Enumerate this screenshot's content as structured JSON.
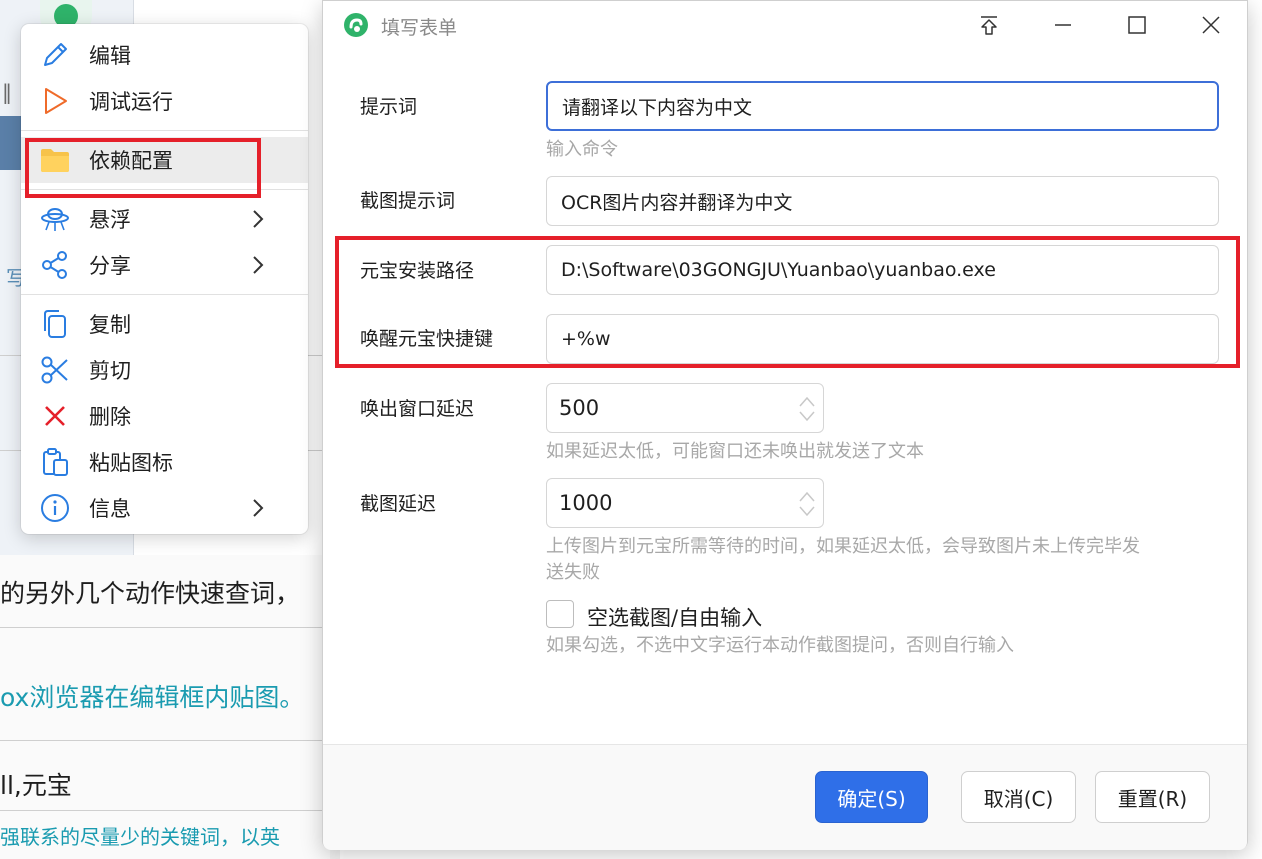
{
  "background": {
    "line1": "的另外几个动作快速查词，",
    "line2": "ox浏览器在编辑框内贴图。",
    "line3": "ll,元宝",
    "line4": "强联系的尽量少的关键词，以英"
  },
  "context_menu": {
    "items": [
      {
        "label": "编辑",
        "icon": "pencil-icon"
      },
      {
        "label": "调试运行",
        "icon": "play-icon"
      },
      {
        "label": "依赖配置",
        "icon": "folder-icon"
      },
      {
        "label": "悬浮",
        "icon": "ufo-icon"
      },
      {
        "label": "分享",
        "icon": "share-icon"
      },
      {
        "label": "复制",
        "icon": "copy-icon"
      },
      {
        "label": "剪切",
        "icon": "scissors-icon"
      },
      {
        "label": "删除",
        "icon": "delete-icon"
      },
      {
        "label": "粘贴图标",
        "icon": "paste-icon"
      },
      {
        "label": "信息",
        "icon": "info-icon"
      }
    ]
  },
  "dialog": {
    "title": "填写表单",
    "fields": {
      "prompt": {
        "label": "提示词",
        "value": "请翻译以下内容为中文",
        "hint": "输入命令"
      },
      "screenshot_prompt": {
        "label": "截图提示词",
        "value": "OCR图片内容并翻译为中文"
      },
      "install_path": {
        "label": "元宝安装路径",
        "value": "D:\\Software\\03GONGJU\\Yuanbao\\yuanbao.exe"
      },
      "hotkey": {
        "label": "唤醒元宝快捷键",
        "value": "+%w"
      },
      "window_delay": {
        "label": "唤出窗口延迟",
        "value": "500",
        "hint": "如果延迟太低，可能窗口还未唤出就发送了文本"
      },
      "screenshot_delay": {
        "label": "截图延迟",
        "value": "1000",
        "hint_line1": "上传图片到元宝所需等待的时间，如果延迟太低，会导致图片未上传完毕发",
        "hint_line2": "送失败"
      },
      "empty_select": {
        "label": "空选截图/自由输入",
        "checked": false,
        "hint": "如果勾选，不选中文字运行本动作截图提问，否则自行输入"
      }
    },
    "buttons": {
      "ok": "确定(S)",
      "cancel": "取消(C)",
      "reset": "重置(R)"
    }
  },
  "colors": {
    "accent": "#2f6fe8",
    "highlight": "#e5202a",
    "brand_green": "#2fb36a"
  }
}
